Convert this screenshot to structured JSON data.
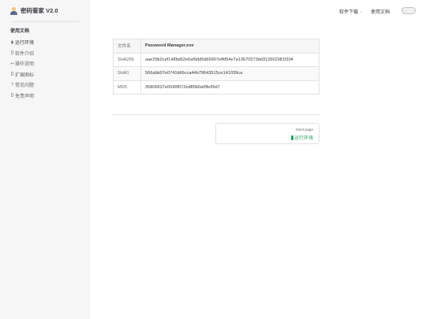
{
  "app": {
    "title": "密码管家 V2.0"
  },
  "header": {
    "nav": [
      {
        "label": "软件下载"
      },
      {
        "label": "使用文档"
      }
    ]
  },
  "sidebar": {
    "heading": "使用文档",
    "items": [
      {
        "icon": "battery-icon",
        "label": "运行环境"
      },
      {
        "icon": "brackets-icon",
        "label": "软件介绍"
      },
      {
        "icon": "arrow-icon",
        "label": "操作说明"
      },
      {
        "icon": "brackets-icon",
        "label": "扩展图标"
      },
      {
        "icon": "question-icon",
        "label": "常见问题"
      },
      {
        "icon": "brackets-icon",
        "label": "免责声明"
      }
    ]
  },
  "hash_table": {
    "headers": [
      "文件名",
      "Password Manager.exe"
    ],
    "rows": [
      [
        "SHA256",
        "aae29b2cef148bd62e6af9dd5db6907effd54e7a13670573dd312662981f334"
      ],
      [
        "SHA1",
        "566abb07e0741b66cca44b79643515ce141039ca"
      ],
      [
        "MD5",
        "35806637e6549f072ed85b0a0ffe95d7"
      ]
    ]
  },
  "next_page": {
    "desc": "Next page",
    "title": "运行环境"
  }
}
